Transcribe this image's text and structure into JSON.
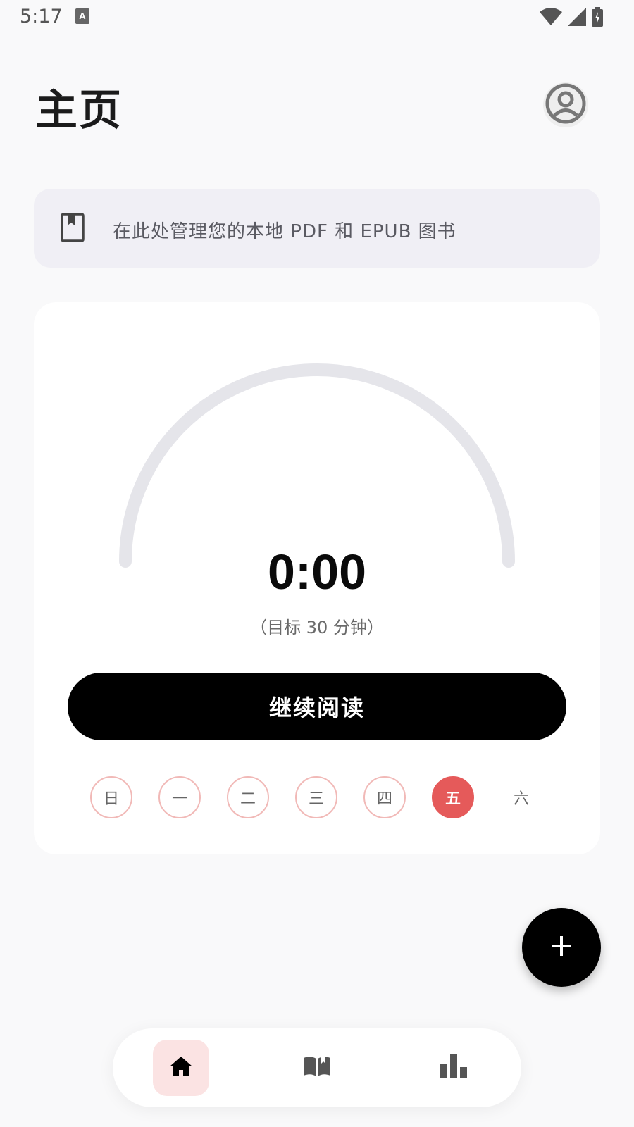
{
  "status_bar": {
    "time": "5:17",
    "icons": [
      "text-notification-icon",
      "wifi-icon",
      "cell-signal-icon",
      "battery-icon"
    ]
  },
  "header": {
    "title": "主页",
    "avatar_icon": "account-circle-icon"
  },
  "info_banner": {
    "icon": "book-bookmark-icon",
    "text": "在此处管理您的本地 PDF 和 EPUB 图书"
  },
  "reading": {
    "progress_fraction": 0,
    "timer": "0:00",
    "goal_text": "（目标 30 分钟）",
    "continue_label": "继续阅读",
    "week_days": [
      {
        "label": "日",
        "state": "outlined"
      },
      {
        "label": "一",
        "state": "outlined"
      },
      {
        "label": "二",
        "state": "outlined"
      },
      {
        "label": "三",
        "state": "outlined"
      },
      {
        "label": "四",
        "state": "outlined"
      },
      {
        "label": "五",
        "state": "today"
      },
      {
        "label": "六",
        "state": "plain"
      }
    ]
  },
  "fab": {
    "icon": "plus-icon"
  },
  "bottom_nav": {
    "items": [
      {
        "icon": "home-icon",
        "selected": true
      },
      {
        "icon": "open-book-icon",
        "selected": false
      },
      {
        "icon": "bar-chart-icon",
        "selected": false
      }
    ]
  },
  "colors": {
    "accent": "#e55a5a",
    "accent_light": "#fbe3e3",
    "gauge_track": "#e5e5ea",
    "banner_bg": "#f0eff5"
  }
}
